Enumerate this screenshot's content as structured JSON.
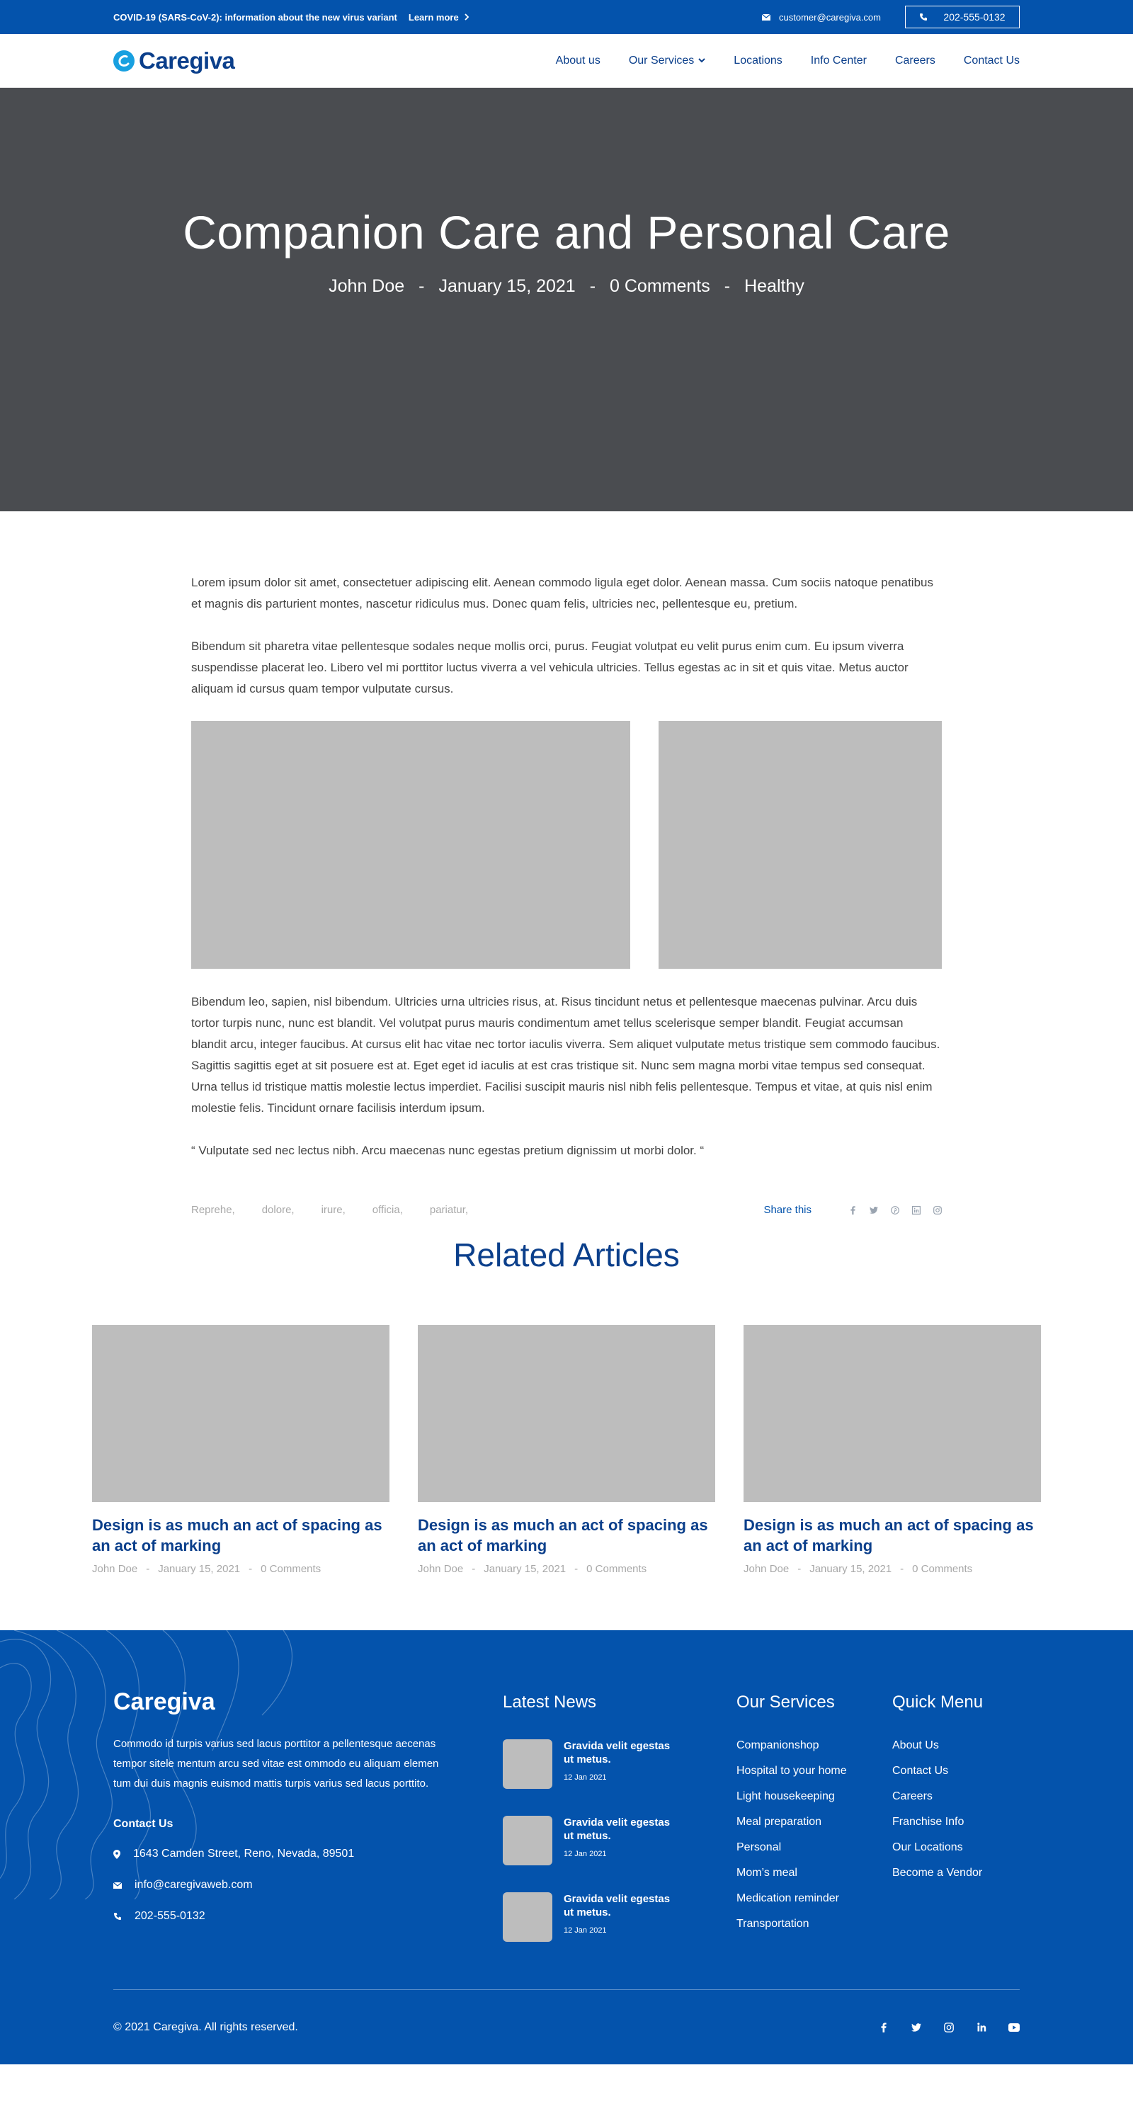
{
  "topbar": {
    "announcement": "COVID-19 (SARS-CoV-2): information about the new virus variant",
    "learn_more": "Learn more",
    "email": "customer@caregiva.com",
    "phone": "202-555-0132"
  },
  "header": {
    "logo": "Caregiva",
    "nav": [
      "About us",
      "Our Services",
      "Locations",
      "Info Center",
      "Careers",
      "Contact Us"
    ]
  },
  "hero": {
    "title": "Companion Care and Personal Care",
    "author": "John Doe",
    "date": "January 15, 2021",
    "comments": "0 Comments",
    "category": "Healthy",
    "separator": "-"
  },
  "article": {
    "p1": "Lorem ipsum dolor sit amet, consectetuer adipiscing elit. Aenean commodo ligula eget dolor. Aenean massa. Cum sociis natoque penatibus et magnis dis parturient montes, nascetur ridiculus mus. Donec quam felis, ultricies nec, pellentesque eu, pretium.",
    "p2": "Bibendum sit pharetra vitae pellentesque sodales neque mollis orci, purus. Feugiat volutpat eu velit purus enim cum. Eu ipsum viverra suspendisse placerat leo. Libero vel mi porttitor luctus viverra a vel vehicula ultricies. Tellus egestas ac in sit et quis vitae. Metus auctor aliquam id cursus quam tempor vulputate cursus.",
    "p3": "Bibendum leo, sapien, nisl bibendum. Ultricies urna ultricies risus, at. Risus tincidunt netus et pellentesque maecenas pulvinar. Arcu duis tortor turpis nunc, nunc est blandit. Vel volutpat purus mauris condimentum amet tellus scelerisque semper blandit. Feugiat accumsan blandit arcu, integer faucibus. At cursus elit hac vitae nec tortor iaculis viverra. Sem aliquet vulputate metus tristique sem commodo faucibus. Sagittis sagittis eget at sit posuere est at. Eget eget id iaculis at est cras tristique sit. Nunc sem magna morbi vitae tempus sed consequat. Urna tellus id tristique mattis molestie lectus imperdiet. Facilisi suscipit mauris nisl nibh felis pellentesque. Tempus et vitae, at quis nisl enim molestie felis. Tincidunt ornare facilisis interdum ipsum.",
    "quote": "“ Vulputate sed nec lectus nibh. Arcu maecenas nunc egestas pretium dignissim ut morbi dolor. “",
    "tags": [
      "Reprehe,",
      "dolore,",
      "irure,",
      "officia,",
      "pariatur,"
    ],
    "share_label": "Share this",
    "share_icons": [
      "facebook-icon",
      "twitter-icon",
      "pinterest-icon",
      "linkedin-icon",
      "instagram-icon"
    ]
  },
  "related": {
    "title": "Related Articles",
    "cards": [
      {
        "title": "Design is as much an act of spacing as an act of marking",
        "author": "John Doe",
        "date": "January 15, 2021",
        "comments": "0 Comments"
      },
      {
        "title": "Design is as much an act of spacing as an act of marking",
        "author": "John Doe",
        "date": "January 15, 2021",
        "comments": "0 Comments"
      },
      {
        "title": "Design is as much an act of spacing as an act of marking",
        "author": "John Doe",
        "date": "January 15, 2021",
        "comments": "0 Comments"
      }
    ]
  },
  "footer": {
    "brand": "Caregiva",
    "about": "Commodo id turpis varius sed lacus porttitor a pellentesque aecenas tempor sitele mentum arcu sed vitae est ommodo eu aliquam elemen tum dui duis magnis euismod mattis turpis varius sed lacus porttito.",
    "contact_title": "Contact Us",
    "address": "1643  Camden Street, Reno, Nevada, 89501",
    "email": "info@caregivaweb.com",
    "phone": "202-555-0132",
    "news_title": "Latest News",
    "news": [
      {
        "title": "Gravida velit egestas ut metus.",
        "date": "12 Jan 2021"
      },
      {
        "title": "Gravida velit egestas ut metus.",
        "date": "12 Jan 2021"
      },
      {
        "title": "Gravida velit egestas ut metus.",
        "date": "12 Jan 2021"
      }
    ],
    "services_title": "Our Services",
    "services": [
      "Companionshop",
      "Hospital to your home",
      "Light housekeeping",
      "Meal preparation",
      "Personal",
      "Mom’s meal",
      "Medication reminder",
      "Transportation"
    ],
    "menu_title": "Quick Menu",
    "menu": [
      "About Us",
      "Contact Us",
      "Careers",
      "Franchise Info",
      "Our Locations",
      "Become a Vendor"
    ],
    "copyright": "© 2021 Caregiva. All rights reserved.",
    "social_icons": [
      "facebook-icon",
      "twitter-icon",
      "instagram-icon",
      "linkedin-icon",
      "youtube-icon"
    ]
  },
  "colors": {
    "brand_blue": "#0453ac",
    "heading_blue": "#0b3f8b",
    "logo_accent": "#18a0e0",
    "hero_bg": "#4a4c50",
    "placeholder": "#bdbdbd"
  }
}
